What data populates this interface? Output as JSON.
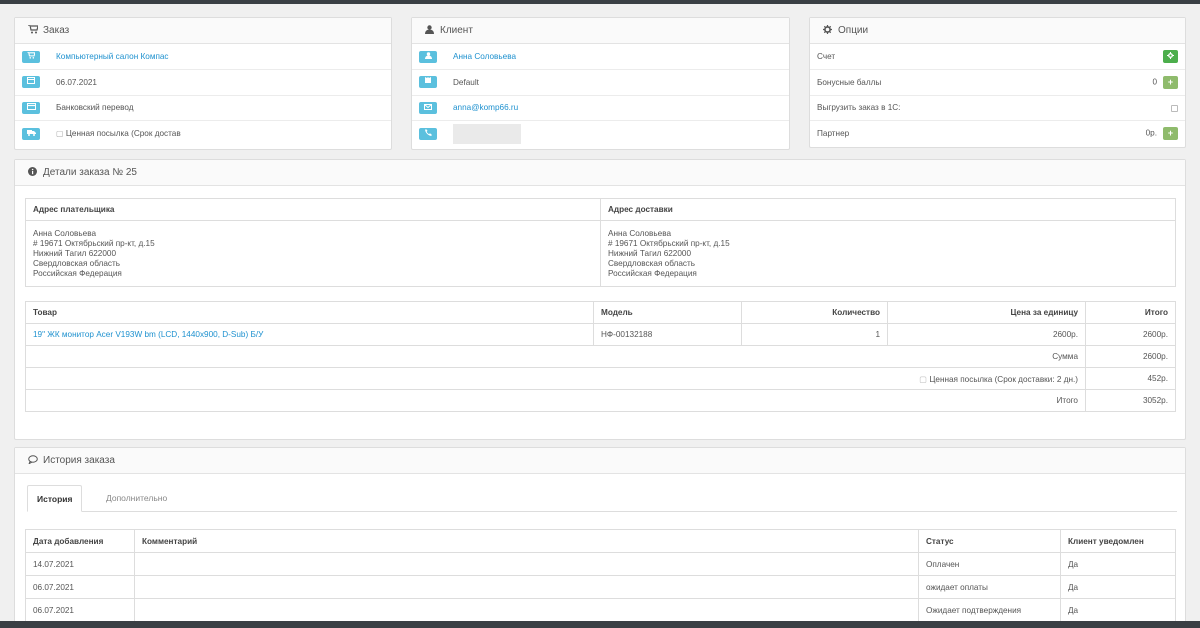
{
  "order_panel": {
    "title": "Заказ",
    "rows": [
      {
        "icon": "cart-icon",
        "text": "Компьютерный салон Компас",
        "link": true
      },
      {
        "icon": "calendar-icon",
        "text": "06.07.2021",
        "link": false
      },
      {
        "icon": "credit-card-icon",
        "text": "Банковский перевод",
        "link": false
      },
      {
        "icon": "truck-icon",
        "text": "Ценная посылка (Срок достав",
        "link": false
      }
    ]
  },
  "client_panel": {
    "title": "Клиент",
    "name": "Анна Соловьева",
    "group": "Default",
    "email": "anna@komp66.ru",
    "phone": ""
  },
  "options_panel": {
    "title": "Опции",
    "invoice_label": "Счет",
    "bonus_label": "Бонусные баллы",
    "bonus_value": "0",
    "export_label": "Выгрузить заказ в 1С:",
    "partner_label": "Партнер",
    "partner_value": "0р."
  },
  "details_panel": {
    "title": "Детали заказа № 25",
    "payment_address_header": "Адрес плательщика",
    "shipping_address_header": "Адрес доставки",
    "payment_address": [
      "Анна Соловьева",
      "# 19671 Октябрьский пр-кт, д.15",
      "Нижний Тагил 622000",
      "Свердловская область",
      "Российская Федерация"
    ],
    "shipping_address": [
      "Анна Соловьева",
      "# 19671 Октябрьский пр-кт, д.15",
      "Нижний Тагил 622000",
      "Свердловская область",
      "Российская Федерация"
    ],
    "products_table": {
      "headers": [
        "Товар",
        "Модель",
        "Количество",
        "Цена за единицу",
        "Итого"
      ],
      "rows": [
        {
          "product": "19\" ЖК монитор Acer V193W bm (LCD, 1440x900, D-Sub) Б/У",
          "model": "НФ-00132188",
          "quantity": "1",
          "price": "2600р.",
          "total": "2600р."
        }
      ],
      "totals": [
        {
          "label": "Сумма",
          "value": "2600р.",
          "has_checkbox": false
        },
        {
          "label": "Ценная посылка (Срок доставки: 2 дн.)",
          "value": "452р.",
          "has_checkbox": true
        },
        {
          "label": "Итого",
          "value": "3052р.",
          "has_checkbox": false
        }
      ]
    }
  },
  "history_panel": {
    "title": "История заказа",
    "tabs": [
      "История",
      "Дополнительно"
    ],
    "headers": [
      "Дата добавления",
      "Комментарий",
      "Статус",
      "Клиент уведомлен"
    ],
    "rows": [
      {
        "date": "14.07.2021",
        "comment": "",
        "status": "Оплачен",
        "notified": "Да"
      },
      {
        "date": "06.07.2021",
        "comment": "",
        "status": "ожидает оплаты",
        "notified": "Да"
      },
      {
        "date": "06.07.2021",
        "comment": "",
        "status": "Ожидает подтверждения",
        "notified": "Да"
      }
    ]
  },
  "colors": {
    "link": "#1e91cf",
    "info_button": "#5bc0de",
    "success_button": "#8fbb6c"
  }
}
